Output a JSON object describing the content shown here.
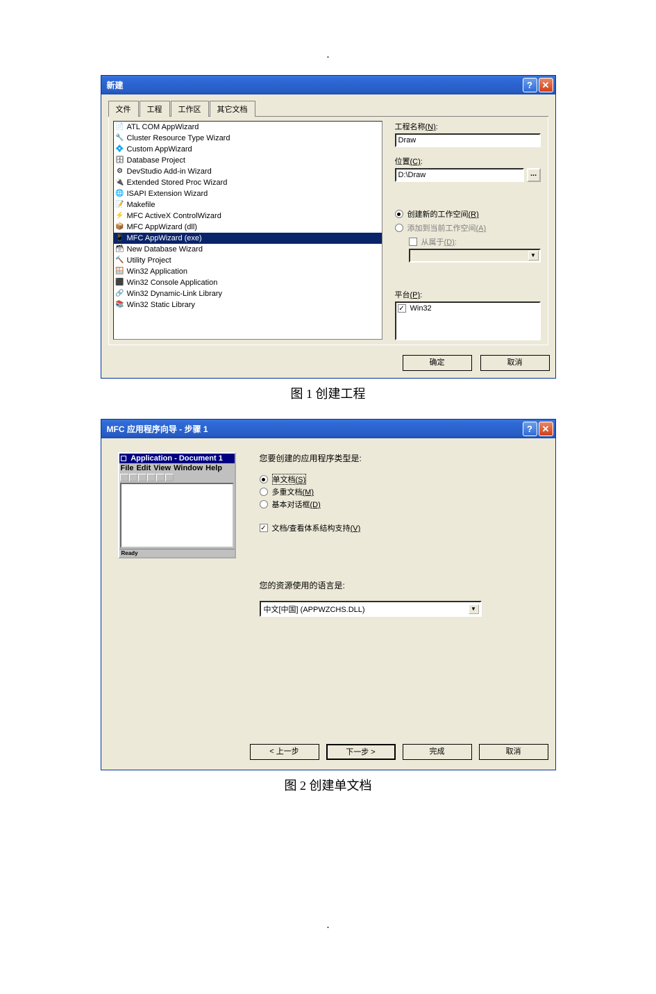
{
  "dot": ".",
  "dot2": ".",
  "dialog1": {
    "title": "新建",
    "tabs": [
      "文件",
      "工程",
      "工作区",
      "其它文档"
    ],
    "list": [
      "ATL COM AppWizard",
      "Cluster Resource Type Wizard",
      "Custom AppWizard",
      "Database Project",
      "DevStudio Add-in Wizard",
      "Extended Stored Proc Wizard",
      "ISAPI Extension Wizard",
      "Makefile",
      "MFC ActiveX ControlWizard",
      "MFC AppWizard (dll)",
      "MFC AppWizard (exe)",
      "New Database Wizard",
      "Utility Project",
      "Win32 Application",
      "Win32 Console Application",
      "Win32 Dynamic-Link Library",
      "Win32 Static Library"
    ],
    "selected_index": 10,
    "proj_name_label": "工程名称(N):",
    "proj_name_key": "N",
    "proj_name_value": "Draw",
    "location_label": "位置(C):",
    "location_key": "C",
    "location_value": "D:\\Draw",
    "browse": "...",
    "radio_new": "创建新的工作空间(R)",
    "radio_new_key": "R",
    "radio_add": "添加到当前工作空间(A)",
    "radio_add_key": "A",
    "cb_depend": "从属于(D):",
    "cb_depend_key": "D",
    "platform_label": "平台(P):",
    "platform_key": "P",
    "platform_item": "Win32",
    "ok": "确定",
    "cancel": "取消"
  },
  "caption1": "图 1   创建工程",
  "dialog2": {
    "title": "MFC 应用程序向导 - 步骤 1",
    "preview_title": "Application - Document 1",
    "preview_menu": [
      "File",
      "Edit",
      "View",
      "Window",
      "Help"
    ],
    "preview_status": "Ready",
    "q1": "您要创建的应用程序类型是:",
    "opt_single": "单文档(S)",
    "opt_single_key": "S",
    "opt_multi": "多重文档(M)",
    "opt_multi_key": "M",
    "opt_dlg": "基本对话框(D)",
    "opt_dlg_key": "D",
    "cb_docview": "文档/查看体系结构支持(V)",
    "cb_docview_key": "V",
    "q2": "您的资源使用的语言是:",
    "lang_value": "中文[中国] (APPWZCHS.DLL)",
    "back": "< 上一步",
    "next": "下一步 >",
    "finish": "完成",
    "cancel": "取消"
  },
  "caption2": "图 2   创建单文档"
}
